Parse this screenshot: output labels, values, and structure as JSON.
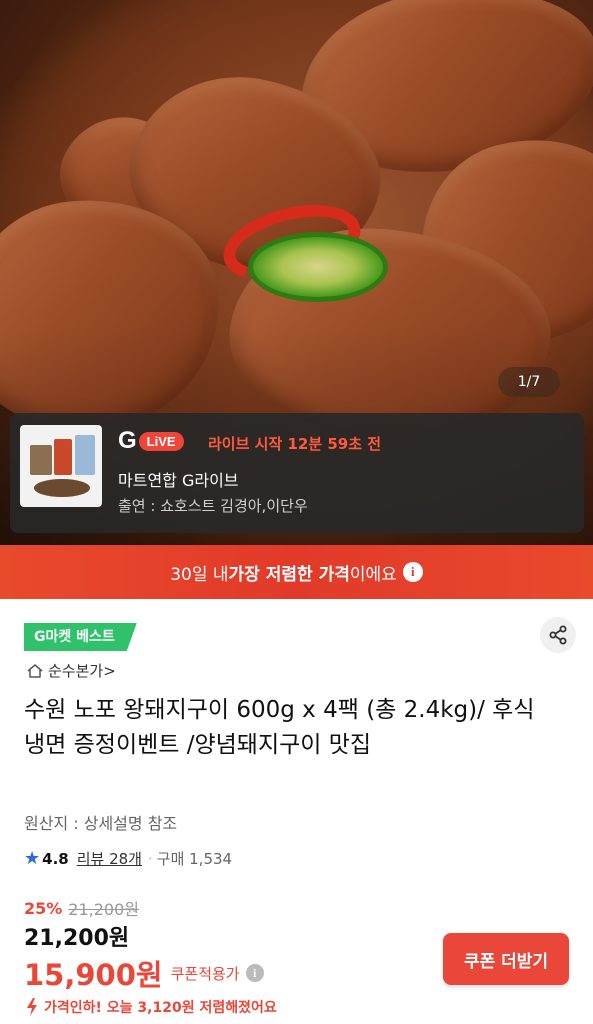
{
  "hero": {
    "image_alt": "marinated pork galbi with chili slices",
    "counter": "1/7"
  },
  "live": {
    "logo_g": "G",
    "logo_live": "LiVE",
    "start_text": "라이브 시작 12분 59초 전",
    "title": "마트연합 G라이브",
    "cast": "출연 : 쇼호스트 김경아,이단우"
  },
  "banner": {
    "prefix": "30일 내 ",
    "highlight": "가장 저렴한 가격",
    "suffix": "이에요",
    "info_icon": "i"
  },
  "product": {
    "badge": "G마켓 베스트",
    "store": "순수본가",
    "store_chevron": ">",
    "title": "수원 노포 왕돼지구이 600g x 4팩 (총 2.4kg)/ 후식냉면 증정이벤트 /양념돼지구이 맛집",
    "origin": "원산지 : 상세설명 참조",
    "rating": {
      "star": "★",
      "score": "4.8",
      "review_link": "리뷰 28개",
      "separator": "·",
      "purchase": "구매 1,534"
    }
  },
  "price": {
    "discount_pct": "25%",
    "original_strike": "21,200원",
    "base": "21,200원",
    "final": "15,900원",
    "coupon_label": "쿠폰적용가",
    "info_icon": "i",
    "drop_notice": "가격인하! 오늘 3,120원 저렴해졌어요"
  },
  "buttons": {
    "coupon_more": "쿠폰 더받기"
  },
  "colors": {
    "accent_red": "#e8473a",
    "best_green": "#2fc26a",
    "rating_blue": "#2a6bd8"
  }
}
